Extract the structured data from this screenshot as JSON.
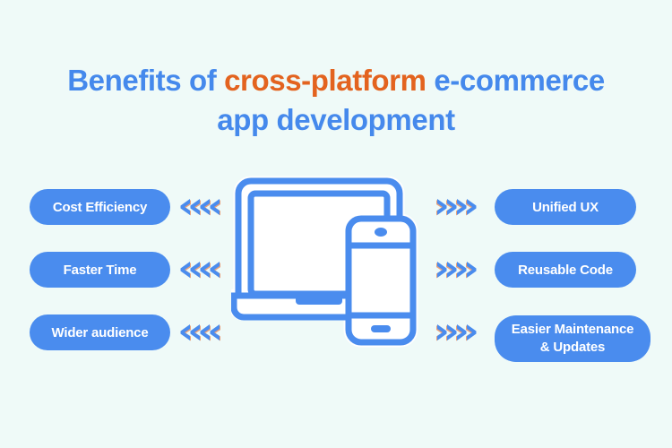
{
  "page": {
    "background_color": "#effaf8",
    "brand_blue": "#4a8cee",
    "title_blue": "#4589ec",
    "accent_orange": "#e3631f",
    "pill_text_color": "#ffffff"
  },
  "title": {
    "line1_part1": "Benefits of ",
    "line1_accent": "cross-platform",
    "line1_part2": " e-commerce",
    "line2": "app development"
  },
  "left_benefits": [
    {
      "label": "Cost Efficiency"
    },
    {
      "label": "Faster Time"
    },
    {
      "label": "Wider audience"
    }
  ],
  "right_benefits": [
    {
      "label": "Unified UX"
    },
    {
      "label": "Reusable Code"
    },
    {
      "label_line1": "Easier Maintenance",
      "label_line2": "& Updates"
    }
  ],
  "arrows": {
    "left_direction": "left",
    "right_direction": "right",
    "chevrons_per_group": 4,
    "color": "#4a8cee",
    "shadow_color": "#e8a07a"
  },
  "illustration": {
    "name": "laptop-and-smartphone",
    "devices": [
      "laptop",
      "smartphone"
    ],
    "stroke_color": "#4a8cee",
    "screen_fill": "#ffffff"
  }
}
